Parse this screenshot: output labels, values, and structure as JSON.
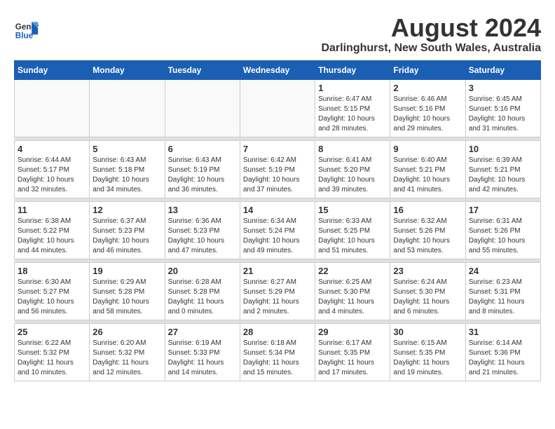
{
  "logo": {
    "line1": "General",
    "line2": "Blue"
  },
  "title": "August 2024",
  "subtitle": "Darlinghurst, New South Wales, Australia",
  "headers": [
    "Sunday",
    "Monday",
    "Tuesday",
    "Wednesday",
    "Thursday",
    "Friday",
    "Saturday"
  ],
  "weeks": [
    [
      {
        "day": "",
        "info": ""
      },
      {
        "day": "",
        "info": ""
      },
      {
        "day": "",
        "info": ""
      },
      {
        "day": "",
        "info": ""
      },
      {
        "day": "1",
        "info": "Sunrise: 6:47 AM\nSunset: 5:15 PM\nDaylight: 10 hours\nand 28 minutes."
      },
      {
        "day": "2",
        "info": "Sunrise: 6:46 AM\nSunset: 5:16 PM\nDaylight: 10 hours\nand 29 minutes."
      },
      {
        "day": "3",
        "info": "Sunrise: 6:45 AM\nSunset: 5:16 PM\nDaylight: 10 hours\nand 31 minutes."
      }
    ],
    [
      {
        "day": "4",
        "info": "Sunrise: 6:44 AM\nSunset: 5:17 PM\nDaylight: 10 hours\nand 32 minutes."
      },
      {
        "day": "5",
        "info": "Sunrise: 6:43 AM\nSunset: 5:18 PM\nDaylight: 10 hours\nand 34 minutes."
      },
      {
        "day": "6",
        "info": "Sunrise: 6:43 AM\nSunset: 5:19 PM\nDaylight: 10 hours\nand 36 minutes."
      },
      {
        "day": "7",
        "info": "Sunrise: 6:42 AM\nSunset: 5:19 PM\nDaylight: 10 hours\nand 37 minutes."
      },
      {
        "day": "8",
        "info": "Sunrise: 6:41 AM\nSunset: 5:20 PM\nDaylight: 10 hours\nand 39 minutes."
      },
      {
        "day": "9",
        "info": "Sunrise: 6:40 AM\nSunset: 5:21 PM\nDaylight: 10 hours\nand 41 minutes."
      },
      {
        "day": "10",
        "info": "Sunrise: 6:39 AM\nSunset: 5:21 PM\nDaylight: 10 hours\nand 42 minutes."
      }
    ],
    [
      {
        "day": "11",
        "info": "Sunrise: 6:38 AM\nSunset: 5:22 PM\nDaylight: 10 hours\nand 44 minutes."
      },
      {
        "day": "12",
        "info": "Sunrise: 6:37 AM\nSunset: 5:23 PM\nDaylight: 10 hours\nand 46 minutes."
      },
      {
        "day": "13",
        "info": "Sunrise: 6:36 AM\nSunset: 5:23 PM\nDaylight: 10 hours\nand 47 minutes."
      },
      {
        "day": "14",
        "info": "Sunrise: 6:34 AM\nSunset: 5:24 PM\nDaylight: 10 hours\nand 49 minutes."
      },
      {
        "day": "15",
        "info": "Sunrise: 6:33 AM\nSunset: 5:25 PM\nDaylight: 10 hours\nand 51 minutes."
      },
      {
        "day": "16",
        "info": "Sunrise: 6:32 AM\nSunset: 5:26 PM\nDaylight: 10 hours\nand 53 minutes."
      },
      {
        "day": "17",
        "info": "Sunrise: 6:31 AM\nSunset: 5:26 PM\nDaylight: 10 hours\nand 55 minutes."
      }
    ],
    [
      {
        "day": "18",
        "info": "Sunrise: 6:30 AM\nSunset: 5:27 PM\nDaylight: 10 hours\nand 56 minutes."
      },
      {
        "day": "19",
        "info": "Sunrise: 6:29 AM\nSunset: 5:28 PM\nDaylight: 10 hours\nand 58 minutes."
      },
      {
        "day": "20",
        "info": "Sunrise: 6:28 AM\nSunset: 5:28 PM\nDaylight: 11 hours\nand 0 minutes."
      },
      {
        "day": "21",
        "info": "Sunrise: 6:27 AM\nSunset: 5:29 PM\nDaylight: 11 hours\nand 2 minutes."
      },
      {
        "day": "22",
        "info": "Sunrise: 6:25 AM\nSunset: 5:30 PM\nDaylight: 11 hours\nand 4 minutes."
      },
      {
        "day": "23",
        "info": "Sunrise: 6:24 AM\nSunset: 5:30 PM\nDaylight: 11 hours\nand 6 minutes."
      },
      {
        "day": "24",
        "info": "Sunrise: 6:23 AM\nSunset: 5:31 PM\nDaylight: 11 hours\nand 8 minutes."
      }
    ],
    [
      {
        "day": "25",
        "info": "Sunrise: 6:22 AM\nSunset: 5:32 PM\nDaylight: 11 hours\nand 10 minutes."
      },
      {
        "day": "26",
        "info": "Sunrise: 6:20 AM\nSunset: 5:32 PM\nDaylight: 11 hours\nand 12 minutes."
      },
      {
        "day": "27",
        "info": "Sunrise: 6:19 AM\nSunset: 5:33 PM\nDaylight: 11 hours\nand 14 minutes."
      },
      {
        "day": "28",
        "info": "Sunrise: 6:18 AM\nSunset: 5:34 PM\nDaylight: 11 hours\nand 15 minutes."
      },
      {
        "day": "29",
        "info": "Sunrise: 6:17 AM\nSunset: 5:35 PM\nDaylight: 11 hours\nand 17 minutes."
      },
      {
        "day": "30",
        "info": "Sunrise: 6:15 AM\nSunset: 5:35 PM\nDaylight: 11 hours\nand 19 minutes."
      },
      {
        "day": "31",
        "info": "Sunrise: 6:14 AM\nSunset: 5:36 PM\nDaylight: 11 hours\nand 21 minutes."
      }
    ]
  ]
}
